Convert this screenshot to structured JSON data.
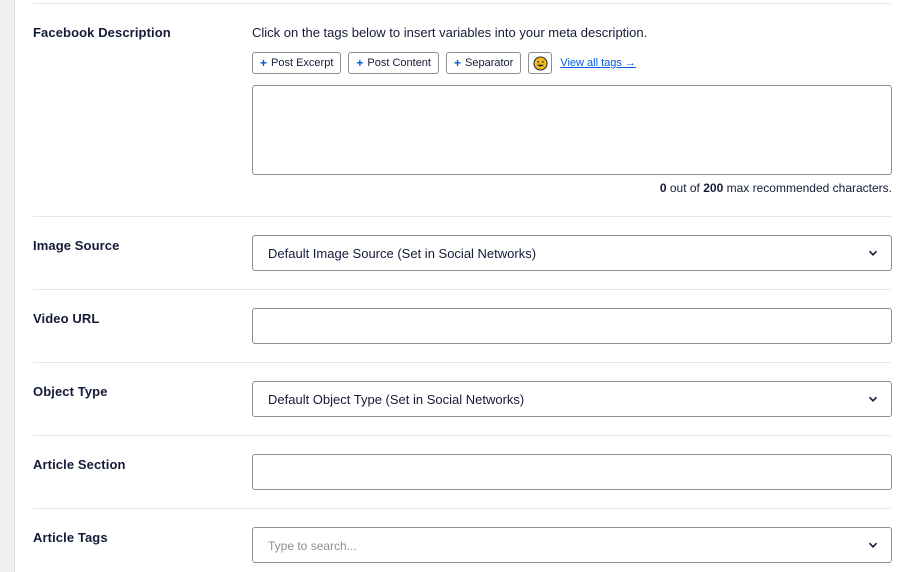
{
  "facebook_description": {
    "label": "Facebook Description",
    "help": "Click on the tags below to insert variables into your meta description.",
    "tags": [
      {
        "label": "Post Excerpt"
      },
      {
        "label": "Post Content"
      },
      {
        "label": "Separator"
      }
    ],
    "emoji_icon": "smiley-icon",
    "view_all": "View all tags →",
    "textarea_value": "",
    "char_count": "0",
    "char_count_middle": " out of ",
    "char_max": "200",
    "char_count_suffix": " max recommended characters."
  },
  "image_source": {
    "label": "Image Source",
    "value": "Default Image Source (Set in Social Networks)"
  },
  "video_url": {
    "label": "Video URL",
    "value": ""
  },
  "object_type": {
    "label": "Object Type",
    "value": "Default Object Type (Set in Social Networks)"
  },
  "article_section": {
    "label": "Article Section",
    "value": ""
  },
  "article_tags": {
    "label": "Article Tags",
    "placeholder": "Type to search..."
  },
  "colors": {
    "accent": "#005ae0",
    "text": "#141b38",
    "border": "#8c8f94",
    "divider": "#e8e8eb"
  }
}
